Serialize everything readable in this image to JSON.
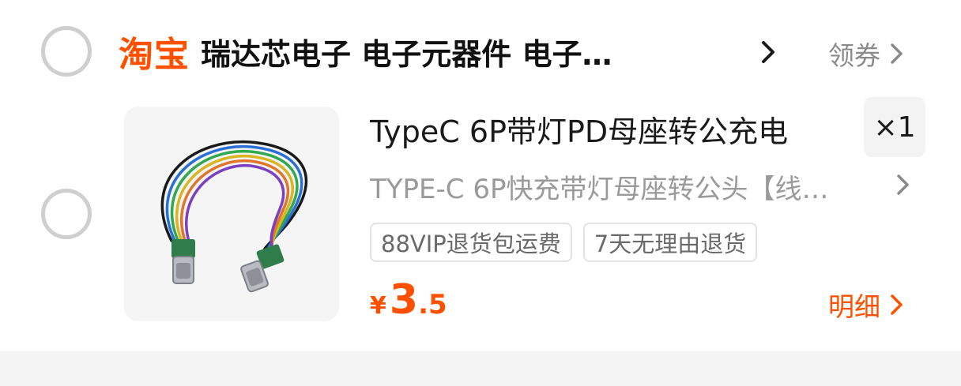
{
  "shop": {
    "platform_logo": "淘宝",
    "name": "瑞达芯电子 电子元器件 电子…",
    "coupon_label": "领券"
  },
  "item": {
    "title": "TypeC 6P带灯PD母座转公充电",
    "quantity": "×1",
    "sku": "TYPE-C 6P快充带灯母座转公头【线…",
    "tags": [
      "88VIP退货包运费",
      "7天无理由退货"
    ],
    "price": {
      "currency": "¥",
      "integer": "3",
      "decimal": ".5"
    },
    "detail_label": "明细"
  },
  "colors": {
    "accent": "#ff5000",
    "muted_text": "#9a9a9a",
    "radio_border": "#cfcfcf",
    "page_bg_strip": "#f4f4f4"
  },
  "icons": {
    "shop_arrow": "chevron-right-icon",
    "coupon_arrow": "chevron-right-icon",
    "sku_arrow": "chevron-right-icon",
    "detail_arrow": "chevron-right-icon"
  }
}
